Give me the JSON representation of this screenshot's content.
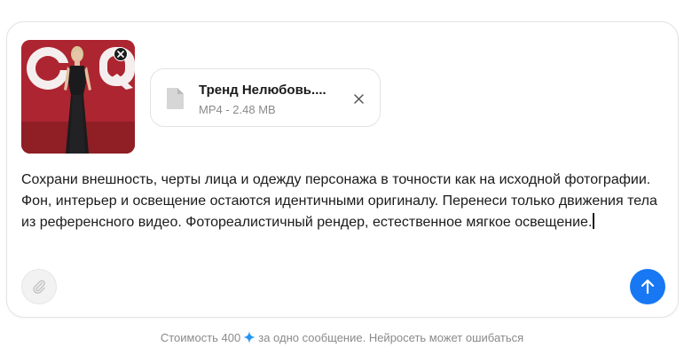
{
  "composer": {
    "image_attachment": {
      "alt": "GQ"
    },
    "file_attachment": {
      "name": "Тренд Нелюбовь....",
      "meta": "MP4 - 2.48 MB"
    },
    "prompt_text": "Сохрани внешность, черты лица и одежду персонажа в точности как на исходной фотографии. Фон, интерьер и освещение остаются идентичными оригиналу. Перенеси только движения тела из референсного видео. Фотореалистичный рендер, естественное мягкое освещение.",
    "icons": {
      "attach": "paperclip-icon",
      "send": "arrow-up-icon",
      "file": "document-icon",
      "remove": "close-icon"
    },
    "colors": {
      "send": "#1877f2",
      "spark": "#2196f3"
    }
  },
  "footer": {
    "cost_prefix": "Стоимость 400",
    "cost_suffix": "за одно сообщение. Нейросеть может ошибаться"
  }
}
